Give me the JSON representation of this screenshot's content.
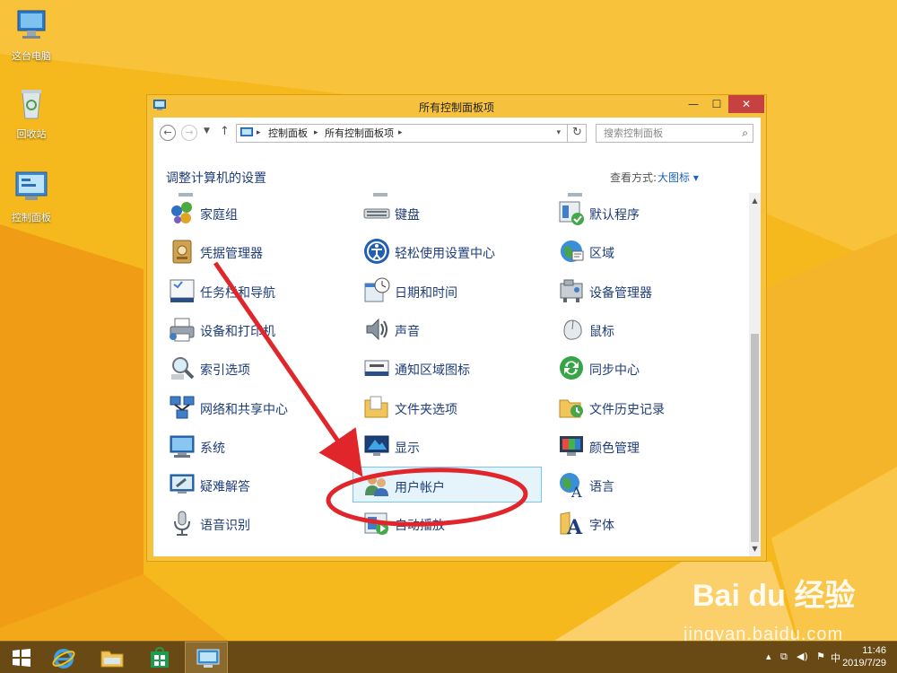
{
  "desktop": {
    "icons": [
      {
        "label": "这台电脑",
        "icon": "computer-icon"
      },
      {
        "label": "回收站",
        "icon": "recycle-bin-icon"
      },
      {
        "label": "控制面板",
        "icon": "control-panel-icon"
      }
    ]
  },
  "window": {
    "title": "所有控制面板项",
    "buttons": {
      "minimize": "—",
      "maximize": "☐",
      "close": "✕"
    },
    "address": {
      "crumbs": [
        "控制面板",
        "所有控制面板项"
      ]
    },
    "search_placeholder": "搜索控制面板",
    "heading": "调整计算机的设置",
    "view_by_label": "查看方式:",
    "view_by_value": "大图标 ▾",
    "items": [
      {
        "label": "家庭组",
        "icon": "homegroup-icon"
      },
      {
        "label": "键盘",
        "icon": "keyboard-icon"
      },
      {
        "label": "默认程序",
        "icon": "default-programs-icon"
      },
      {
        "label": "凭据管理器",
        "icon": "credential-manager-icon"
      },
      {
        "label": "轻松使用设置中心",
        "icon": "ease-of-access-icon"
      },
      {
        "label": "区域",
        "icon": "region-icon"
      },
      {
        "label": "任务栏和导航",
        "icon": "taskbar-icon"
      },
      {
        "label": "日期和时间",
        "icon": "date-time-icon"
      },
      {
        "label": "设备管理器",
        "icon": "device-manager-icon"
      },
      {
        "label": "设备和打印机",
        "icon": "printer-icon"
      },
      {
        "label": "声音",
        "icon": "sound-icon"
      },
      {
        "label": "鼠标",
        "icon": "mouse-icon"
      },
      {
        "label": "索引选项",
        "icon": "indexing-icon"
      },
      {
        "label": "通知区域图标",
        "icon": "notification-icon"
      },
      {
        "label": "同步中心",
        "icon": "sync-center-icon"
      },
      {
        "label": "网络和共享中心",
        "icon": "network-icon"
      },
      {
        "label": "文件夹选项",
        "icon": "folder-options-icon"
      },
      {
        "label": "文件历史记录",
        "icon": "file-history-icon"
      },
      {
        "label": "系统",
        "icon": "system-icon"
      },
      {
        "label": "显示",
        "icon": "display-icon"
      },
      {
        "label": "颜色管理",
        "icon": "color-management-icon"
      },
      {
        "label": "疑难解答",
        "icon": "troubleshooting-icon"
      },
      {
        "label": "用户帐户",
        "icon": "user-accounts-icon",
        "selected": true
      },
      {
        "label": "语言",
        "icon": "language-icon"
      },
      {
        "label": "语音识别",
        "icon": "speech-recognition-icon"
      },
      {
        "label": "自动播放",
        "icon": "autoplay-icon"
      },
      {
        "label": "字体",
        "icon": "fonts-icon"
      }
    ]
  },
  "taskbar": {
    "time": "11:46",
    "date": "2019/7/29",
    "ime": "中"
  },
  "watermark": {
    "brand": "Bai du 经验",
    "url": "jingyan.baidu.com"
  },
  "annotation_color": "#e0262b"
}
